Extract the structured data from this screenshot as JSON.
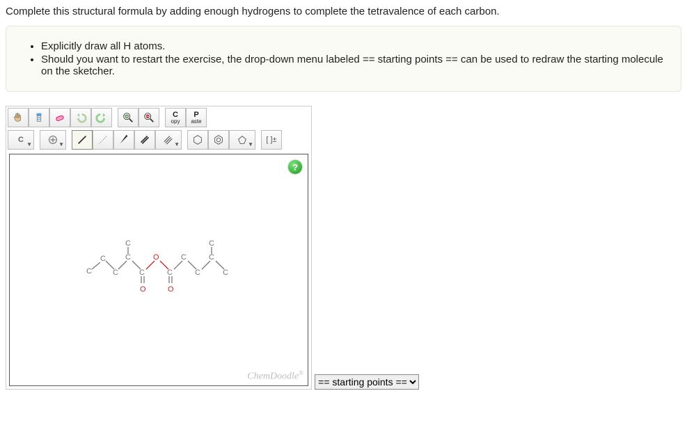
{
  "prompt": "Complete this structural formula by adding enough hydrogens to complete the tetravalence of each carbon.",
  "instructions": {
    "items": [
      "Explicitly draw all H atoms.",
      "Should you want to restart the exercise, the drop-down menu labeled == starting points == can be used to redraw the starting molecule on the sketcher."
    ]
  },
  "toolbar": {
    "row1": {
      "copy_top": "C",
      "copy_bottom": "opy",
      "paste_top": "P",
      "paste_bottom": "aste"
    },
    "row2": {
      "element_label": "C",
      "charge_label": "[ ]±"
    }
  },
  "canvas": {
    "help_label": "?",
    "brand": "ChemDoodle",
    "brand_mark": "®",
    "atoms": {
      "c": "C",
      "o": "O"
    }
  },
  "dropdown": {
    "selected": "== starting points =="
  }
}
